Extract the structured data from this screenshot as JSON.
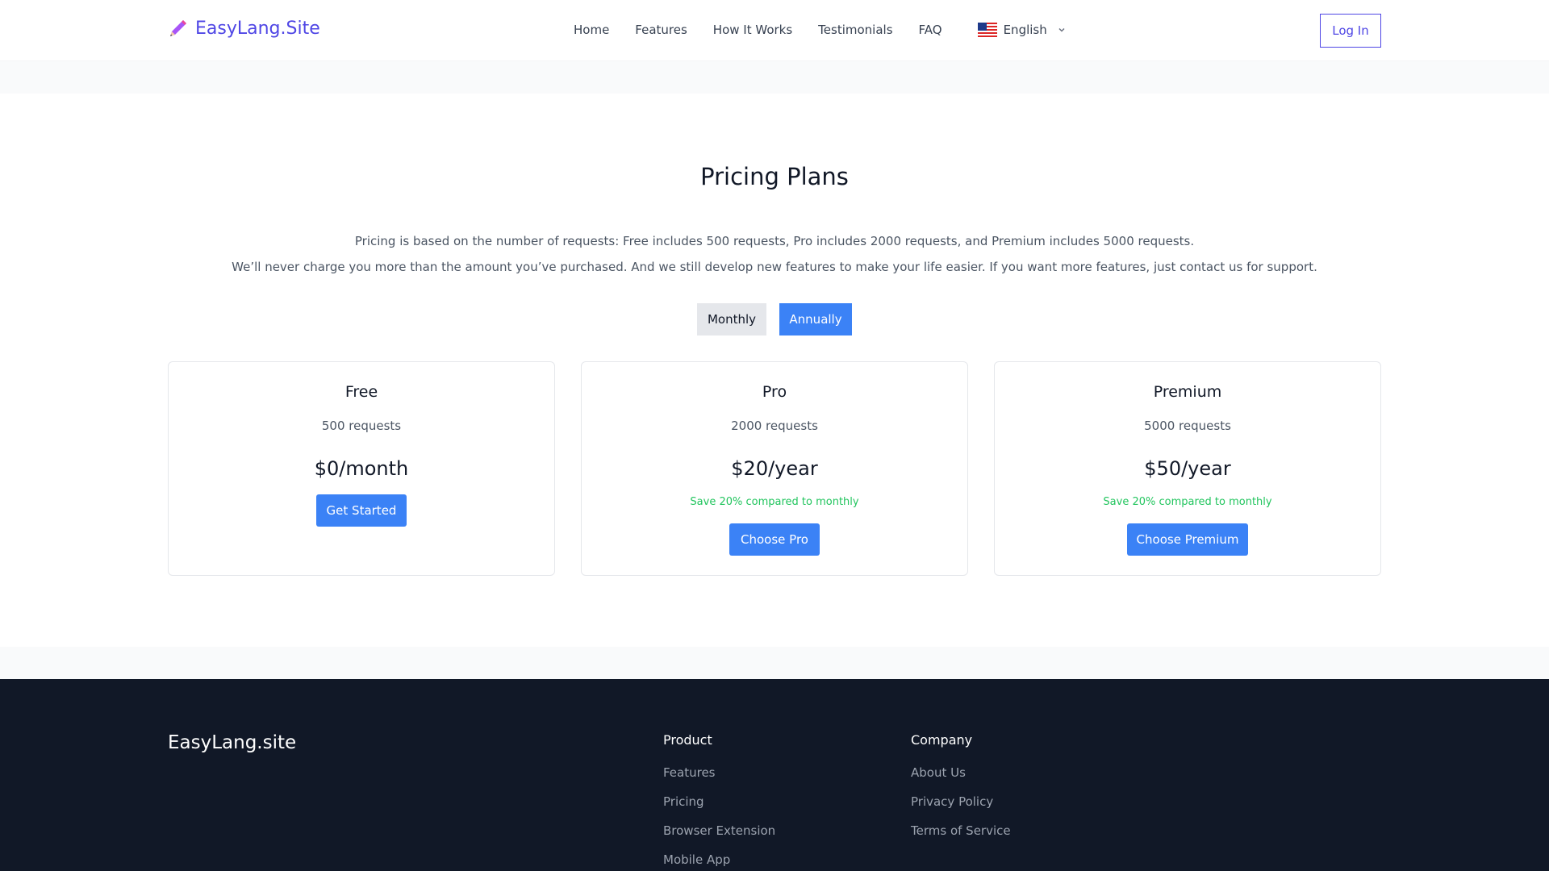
{
  "header": {
    "logo_text": "EasyLang.Site",
    "nav": [
      "Home",
      "Features",
      "How It Works",
      "Testimonials",
      "FAQ"
    ],
    "language": "English",
    "login_label": "Log In"
  },
  "pricing": {
    "title": "Pricing Plans",
    "desc1": "Pricing is based on the number of requests: Free includes 500 requests, Pro includes 2000 requests, and Premium includes 5000 requests.",
    "desc2": "We’ll never charge you more than the amount you’ve purchased. And we still develop new features to make your life easier. If you want more features, just contact us for support.",
    "toggle": {
      "monthly": "Monthly",
      "annually": "Annually",
      "selected": "Annually"
    },
    "plans": [
      {
        "name": "Free",
        "requests": "500 requests",
        "price": "$0/month",
        "save": "",
        "button": "Get Started"
      },
      {
        "name": "Pro",
        "requests": "2000 requests",
        "price": "$20/year",
        "save": "Save 20% compared to monthly",
        "button": "Choose Pro"
      },
      {
        "name": "Premium",
        "requests": "5000 requests",
        "price": "$50/year",
        "save": "Save 20% compared to monthly",
        "button": "Choose Premium"
      }
    ]
  },
  "footer": {
    "brand": "EasyLang.site",
    "product": {
      "heading": "Product",
      "links": [
        "Features",
        "Pricing",
        "Browser Extension",
        "Mobile App"
      ]
    },
    "company": {
      "heading": "Company",
      "links": [
        "About Us",
        "Privacy Policy",
        "Terms of Service"
      ]
    }
  },
  "colors": {
    "brand": "#4f46e5",
    "primary_button": "#3b82f6",
    "save_text": "#22c55e",
    "footer_bg": "#111827"
  },
  "icons": {
    "logo": "pencil-icon",
    "flag": "us-flag-icon",
    "dropdown": "chevron-down-icon"
  }
}
